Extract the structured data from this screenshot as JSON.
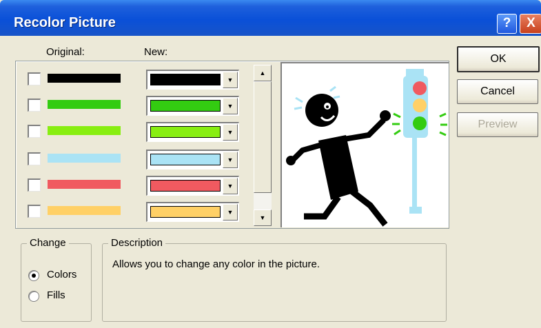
{
  "window": {
    "title": "Recolor Picture",
    "help_label": "?",
    "close_label": "X"
  },
  "columns": {
    "original": "Original:",
    "new": "New:"
  },
  "rows": [
    {
      "original_color": "#000000",
      "new_color": "#000000",
      "checked": false
    },
    {
      "original_color": "#33cc11",
      "new_color": "#33cc11",
      "checked": false
    },
    {
      "original_color": "#88ee11",
      "new_color": "#88ee11",
      "checked": false
    },
    {
      "original_color": "#aae3f5",
      "new_color": "#aae3f5",
      "checked": false
    },
    {
      "original_color": "#f05a60",
      "new_color": "#f05a60",
      "checked": false
    },
    {
      "original_color": "#ffd066",
      "new_color": "#ffd066",
      "checked": false
    }
  ],
  "buttons": {
    "ok": "OK",
    "cancel": "Cancel",
    "preview": "Preview"
  },
  "change": {
    "title": "Change",
    "colors_label": "Colors",
    "fills_label": "Fills",
    "selected": "Colors"
  },
  "description": {
    "title": "Description",
    "text": "Allows you to change any color in the picture."
  }
}
